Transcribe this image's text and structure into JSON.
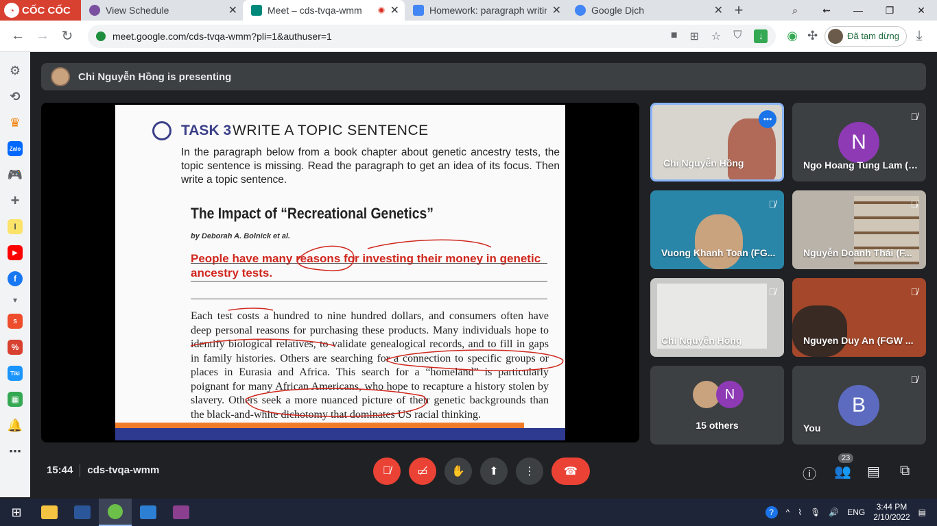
{
  "browser": {
    "brand": "CỐC CỐC",
    "tabs": [
      {
        "title": "View Schedule",
        "favicon_color": "#7b4fa0"
      },
      {
        "title": "Meet – cds-tvqa-wmm",
        "favicon_color": "#00897b"
      },
      {
        "title": "Homework: paragraph writin",
        "favicon_color": "#4285f4"
      },
      {
        "title": "Google Dịch",
        "favicon_color": "#4285f4"
      }
    ],
    "url": "meet.google.com/cds-tvqa-wmm?pli=1&authuser=1",
    "profile_status": "Đã tạm dừng"
  },
  "meet": {
    "presenting_banner": "Chi Nguyễn Hồng is presenting",
    "slide": {
      "task_label": "TASK 3",
      "task_title": "WRITE A TOPIC SENTENCE",
      "instructions": "In the paragraph below from a book chapter about genetic ancestry tests, the topic sentence is missing. Read the paragraph to get an idea of its focus. Then write a topic sentence.",
      "heading": "The Impact of “Recreational Genetics”",
      "author": "by Deborah A. Bolnick et al.",
      "topic_sentence": "People have many reasons for investing their money in genetic ancestry tests.",
      "body": "Each test costs a hundred to nine hundred dollars, and consumers often have deep personal reasons for purchasing these products. Many individuals hope to identify biological relatives, to validate genealogical records, and to fill in gaps in family histories. Others are searching for a connection to specific groups or places in Eurasia and Africa. This search for a “homeland” is particularly poignant for many African Americans, who hope to recapture a history stolen by slavery. Others seek a more nuanced picture of their genetic backgrounds than the black-and-white dichotomy that dominates US racial thinking."
    },
    "participants": [
      {
        "name": "Chi Nguyễn Hồng",
        "speaking": true,
        "bg": "#d8d5cf"
      },
      {
        "name": "Ngo Hoang Tung Lam (F...",
        "initial": "N",
        "avatar_color": "#8e3ab5"
      },
      {
        "name": "Vuong Khanh Toan (FG...",
        "bg": "#2a86a8"
      },
      {
        "name": "Nguyễn Doanh Thái (F...",
        "bg": "#b9b3aa"
      },
      {
        "name": "Chi Nguyễn Hồng",
        "bg": "#c9c9c7"
      },
      {
        "name": "Nguyen Duy An (FGW ...",
        "bg": "#a4472a"
      },
      {
        "name": "15 others",
        "initial": "N",
        "avatar_color": "#8e3ab5"
      },
      {
        "name": "You",
        "initial": "B",
        "avatar_color": "#5c6bc0"
      }
    ],
    "time": "15:44",
    "meeting_code": "cds-tvqa-wmm",
    "people_count": "23"
  },
  "taskbar": {
    "language": "ENG",
    "time": "3:44 PM",
    "date": "2/10/2022"
  }
}
